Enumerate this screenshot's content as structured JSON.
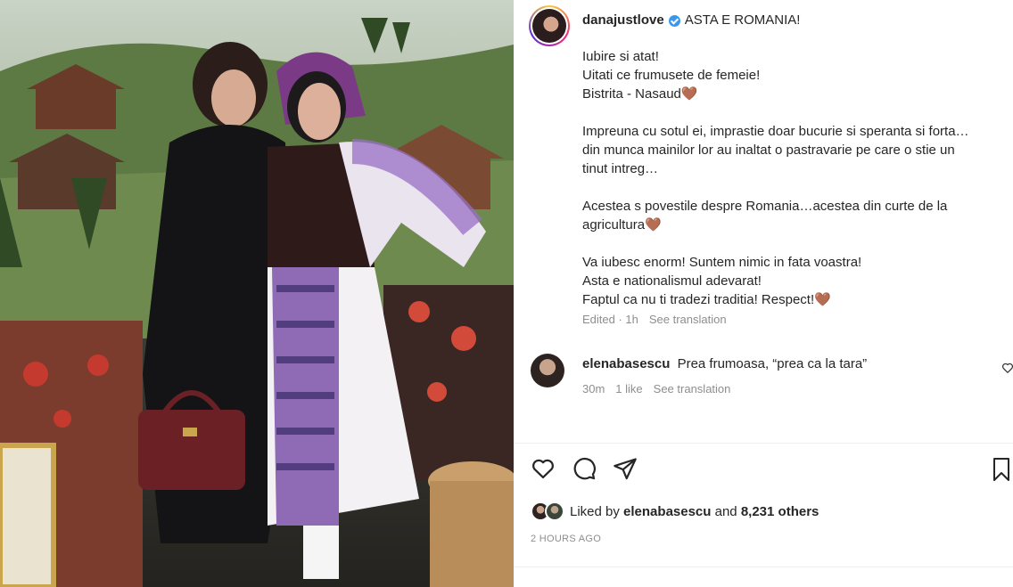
{
  "post": {
    "username": "danajustlove",
    "title": "ASTA E ROMANIA!",
    "caption_lines": [
      "Iubire si atat!",
      "Uitati ce frumusete de femeie!",
      "Bistrita - Nasaud",
      "",
      "Impreuna cu sotul ei, imprastie doar bucurie si speranta si forta…",
      "din munca mainilor lor au inaltat o pastravarie pe care o stie un",
      "tinut intreg…",
      "",
      "Acestea s povestile despre Romania…acestea din curte de la",
      "agricultura",
      "",
      "Va iubesc enorm! Suntem nimic in fata voastra!",
      "Asta e nationalismul adevarat!",
      "Faptul ca nu ti tradezi traditia! Respect!"
    ],
    "heart_emoji": "🤎",
    "edited": "Edited · 1h",
    "see_translation": "See translation"
  },
  "comment": {
    "username": "elenabasescu",
    "text": "Prea frumoasa, “prea ca la tara”",
    "time": "30m",
    "likes": "1 like",
    "see_translation": "See translation"
  },
  "likes": {
    "prefix": "Liked by ",
    "user": "elenabasescu",
    "middle": " and ",
    "others": "8,231 others"
  },
  "time_ago": "2 HOURS AGO",
  "colors": {
    "verified": "#3897f0",
    "muted_text": "#8e8e8e",
    "text": "#262626"
  },
  "icons": [
    "verified-badge-icon",
    "heart-icon",
    "comment-icon",
    "share-icon",
    "bookmark-icon",
    "comment-like-heart-icon"
  ]
}
